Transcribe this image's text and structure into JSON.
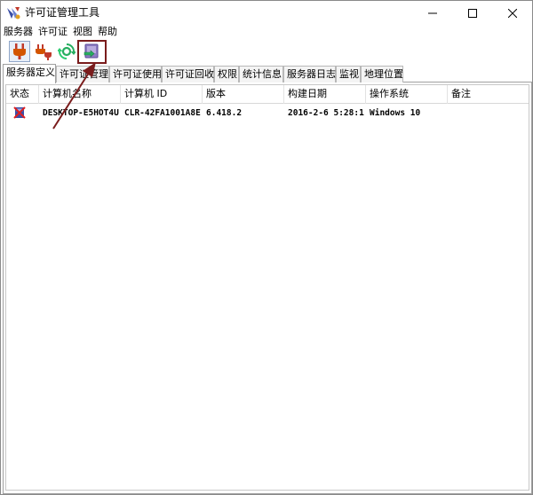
{
  "window": {
    "title": "许可证管理工具"
  },
  "menu": {
    "items": [
      "服务器",
      "许可证",
      "视图",
      "帮助"
    ]
  },
  "toolbar": {
    "buttons": [
      {
        "icon": "plug-connected-icon",
        "pressed": true
      },
      {
        "icon": "plug-disconnected-icon",
        "pressed": false
      },
      {
        "icon": "refresh-icon",
        "pressed": false
      },
      {
        "icon": "import-server-icon",
        "pressed": false,
        "highlighted": true
      }
    ]
  },
  "tabs": [
    "服务器定义",
    "许可证管理",
    "许可证使用",
    "许可证回收",
    "权限",
    "统计信息",
    "服务器日志",
    "监视",
    "地理位置"
  ],
  "active_tab": 0,
  "table": {
    "columns": [
      "状态",
      "计算机名称",
      "计算机 ID",
      "版本",
      "构建日期",
      "操作系统",
      "备注"
    ],
    "rows": [
      {
        "status_icon": "server-disconnected-icon",
        "computer_name": "DESKTOP-E5HOT4U",
        "computer_id": "CLR-42FA1001A8E",
        "version": "6.418.2",
        "build_date": "2016-2-6 5:28:1",
        "os": "Windows 10",
        "note": ""
      }
    ]
  },
  "colors": {
    "highlight_border": "#7a1c1c",
    "arrow": "#7a1c1c"
  }
}
